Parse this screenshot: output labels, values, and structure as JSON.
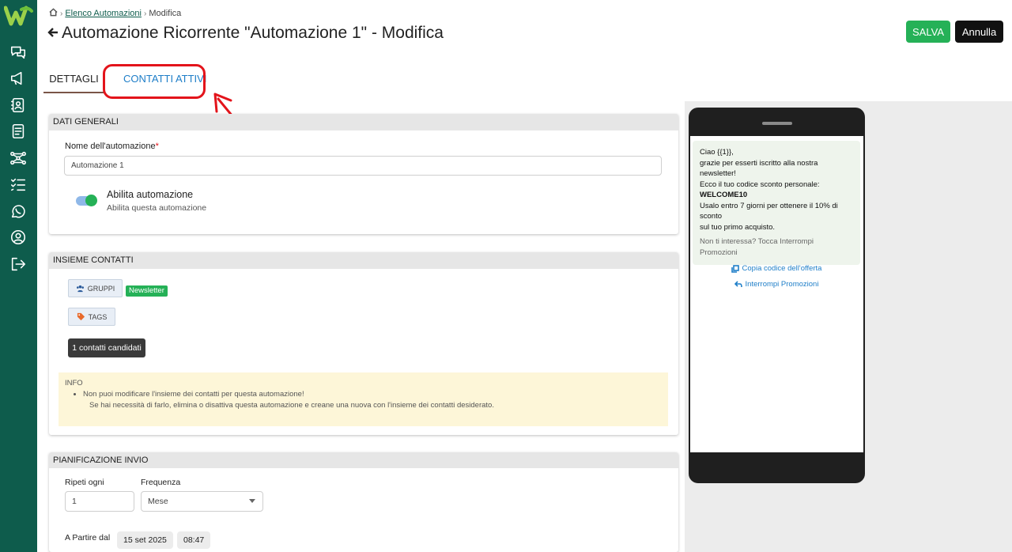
{
  "breadcrumb": {
    "link": "Elenco Automazioni",
    "sep": "›",
    "current": "Modifica"
  },
  "header": {
    "title": "Automazione Ricorrente \"Automazione 1\" - Modifica",
    "save_label": "SALVA",
    "cancel_label": "Annulla"
  },
  "tabs": [
    {
      "label": "DETTAGLI"
    },
    {
      "label": "CONTATTI ATTIVI"
    }
  ],
  "general": {
    "header": "DATI GENERALI",
    "name_label": "Nome dell'automazione",
    "required_mark": "*",
    "name_value": "Automazione 1",
    "toggle_title": "Abilita automazione",
    "toggle_subtitle": "Abilita questa automazione"
  },
  "contacts": {
    "header": "INSIEME CONTATTI",
    "groups_label": "GRUPPI",
    "group_badge": "Newsletter",
    "tags_label": "TAGS",
    "candidates": "1 contatti candidati",
    "info_title": "INFO",
    "info_line1": "Non puoi modificare l'insieme dei contatti per questa automazione!",
    "info_line2": "Se hai necessità di farlo, elimina o disattiva questa automazione e creane una nuova con l'insieme dei contatti desiderato."
  },
  "schedule": {
    "header": "PIANIFICAZIONE INVIO",
    "repeat_label": "Ripeti ogni",
    "repeat_value": "1",
    "freq_label": "Frequenza",
    "freq_value": "Mese",
    "start_label": "A Partire dal",
    "start_date": "15 set 2025",
    "start_time": "08:47"
  },
  "preview": {
    "lines": [
      "Ciao {{1}},",
      "grazie per esserti iscritto alla nostra newsletter!",
      "Ecco il tuo codice sconto personale:"
    ],
    "code": "WELCOME10",
    "lines2": [
      "Usalo entro 7 giorni per ottenere il 10% di sconto",
      "sul tuo primo acquisto."
    ],
    "footer": "Non ti interessa? Tocca Interrompi Promozioni",
    "action1": "Copia codice dell'offerta",
    "action2": "Interrompi Promozioni"
  },
  "colors": {
    "brand": "#0e5c4c",
    "accent_green": "#25b157",
    "highlight_red": "#e3141b",
    "link_blue": "#1e7ec8"
  }
}
